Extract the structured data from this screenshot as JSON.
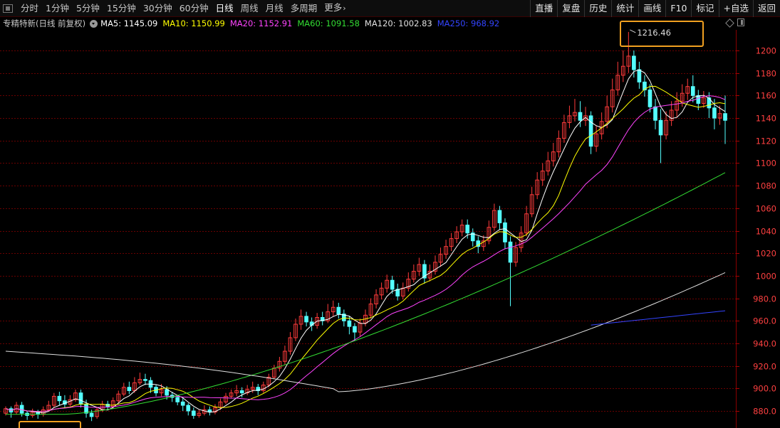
{
  "toolbar": {
    "periods": [
      {
        "label": "分时"
      },
      {
        "label": "1分钟"
      },
      {
        "label": "5分钟"
      },
      {
        "label": "15分钟"
      },
      {
        "label": "30分钟"
      },
      {
        "label": "60分钟"
      },
      {
        "label": "日线"
      },
      {
        "label": "周线"
      },
      {
        "label": "月线"
      },
      {
        "label": "多周期"
      },
      {
        "label": "更多"
      }
    ],
    "active_period": "日线",
    "tools": [
      {
        "label": "直播"
      },
      {
        "label": "复盘"
      },
      {
        "label": "历史"
      },
      {
        "label": "统计"
      },
      {
        "label": "画线"
      },
      {
        "label": "F10"
      },
      {
        "label": "标记"
      },
      {
        "label": "+自选"
      },
      {
        "label": "返回"
      }
    ]
  },
  "legend": {
    "title": "专精特新(日线 前复权)",
    "items": [
      {
        "label": "MA5:",
        "value": "1145.09",
        "color": "#ffffff"
      },
      {
        "label": "MA10:",
        "value": "1150.99",
        "color": "#ffff00"
      },
      {
        "label": "MA20:",
        "value": "1152.91",
        "color": "#ff44ff"
      },
      {
        "label": "MA60:",
        "value": "1091.58",
        "color": "#33dd33"
      },
      {
        "label": "MA120:",
        "value": "1002.83",
        "color": "#e0e0e0"
      },
      {
        "label": "MA250:",
        "value": "968.92",
        "color": "#3344ff"
      }
    ]
  },
  "chart_data": {
    "type": "candlestick",
    "ylim": [
      870,
      1217
    ],
    "y_ticks": [
      "880.0",
      "900.0",
      "920.0",
      "940.0",
      "960.0",
      "980.0",
      "1000",
      "1020",
      "1040",
      "1060",
      "1080",
      "1100",
      "1120",
      "1140",
      "1160",
      "1180",
      "1200"
    ],
    "grid": true,
    "colors": {
      "up": "#ff3b3b",
      "down": "#54ffff",
      "grid": "#6a0000"
    },
    "annotation": {
      "label": "1216.46",
      "value": 1216.46
    },
    "candles": [
      [
        878,
        882,
        876,
        884
      ],
      [
        882,
        879,
        874,
        884
      ],
      [
        879,
        885,
        877,
        888
      ],
      [
        885,
        878,
        875,
        888
      ],
      [
        878,
        876,
        872,
        880
      ],
      [
        876,
        879,
        874,
        882
      ],
      [
        879,
        877,
        873,
        881
      ],
      [
        877,
        881,
        875,
        884
      ],
      [
        881,
        885,
        880,
        889
      ],
      [
        885,
        893,
        883,
        896
      ],
      [
        893,
        889,
        885,
        897
      ],
      [
        889,
        886,
        883,
        894
      ],
      [
        886,
        890,
        884,
        894
      ],
      [
        890,
        896,
        888,
        899
      ],
      [
        896,
        886,
        883,
        899
      ],
      [
        886,
        878,
        874,
        890
      ],
      [
        878,
        875,
        871,
        881
      ],
      [
        875,
        881,
        873,
        883
      ],
      [
        881,
        886,
        879,
        889
      ],
      [
        886,
        884,
        881,
        889
      ],
      [
        884,
        889,
        882,
        892
      ],
      [
        889,
        895,
        887,
        898
      ],
      [
        895,
        901,
        893,
        905
      ],
      [
        901,
        898,
        895,
        906
      ],
      [
        898,
        905,
        896,
        910
      ],
      [
        905,
        908,
        903,
        914
      ],
      [
        908,
        907,
        903,
        913
      ],
      [
        907,
        901,
        896,
        910
      ],
      [
        901,
        896,
        893,
        903
      ],
      [
        896,
        899,
        893,
        904
      ],
      [
        899,
        894,
        890,
        902
      ],
      [
        894,
        892,
        888,
        897
      ],
      [
        892,
        888,
        885,
        894
      ],
      [
        888,
        885,
        880,
        892
      ],
      [
        885,
        880,
        876,
        887
      ],
      [
        880,
        876,
        873,
        883
      ],
      [
        876,
        878,
        874,
        881
      ],
      [
        878,
        881,
        876,
        885
      ],
      [
        881,
        879,
        876,
        884
      ],
      [
        879,
        883,
        877,
        886
      ],
      [
        883,
        888,
        881,
        891
      ],
      [
        888,
        893,
        886,
        896
      ],
      [
        893,
        896,
        891,
        899
      ],
      [
        896,
        898,
        893,
        903
      ],
      [
        898,
        896,
        892,
        901
      ],
      [
        896,
        899,
        894,
        903
      ],
      [
        899,
        901,
        896,
        906
      ],
      [
        901,
        898,
        894,
        904
      ],
      [
        898,
        903,
        896,
        906
      ],
      [
        903,
        910,
        901,
        913
      ],
      [
        910,
        918,
        908,
        921
      ],
      [
        918,
        924,
        915,
        928
      ],
      [
        924,
        933,
        921,
        938
      ],
      [
        933,
        945,
        930,
        950
      ],
      [
        945,
        957,
        942,
        962
      ],
      [
        957,
        964,
        952,
        970
      ],
      [
        964,
        959,
        955,
        968
      ],
      [
        959,
        956,
        951,
        963
      ],
      [
        956,
        963,
        953,
        967
      ],
      [
        963,
        960,
        956,
        968
      ],
      [
        960,
        968,
        958,
        975
      ],
      [
        968,
        972,
        964,
        978
      ],
      [
        972,
        966,
        962,
        976
      ],
      [
        966,
        960,
        955,
        970
      ],
      [
        960,
        955,
        948,
        964
      ],
      [
        955,
        950,
        942,
        958
      ],
      [
        950,
        958,
        946,
        962
      ],
      [
        958,
        965,
        955,
        970
      ],
      [
        965,
        975,
        962,
        980
      ],
      [
        975,
        983,
        971,
        988
      ],
      [
        983,
        989,
        979,
        994
      ],
      [
        989,
        996,
        985,
        1001
      ],
      [
        996,
        988,
        984,
        1000
      ],
      [
        988,
        982,
        978,
        993
      ],
      [
        982,
        989,
        979,
        994
      ],
      [
        989,
        997,
        986,
        1003
      ],
      [
        997,
        1004,
        994,
        1010
      ],
      [
        1004,
        1010,
        1000,
        1016
      ],
      [
        1010,
        998,
        993,
        1014
      ],
      [
        998,
        1004,
        995,
        1010
      ],
      [
        1004,
        1012,
        1001,
        1018
      ],
      [
        1012,
        1019,
        1008,
        1025
      ],
      [
        1019,
        1026,
        1015,
        1032
      ],
      [
        1026,
        1033,
        1022,
        1038
      ],
      [
        1033,
        1039,
        1029,
        1044
      ],
      [
        1039,
        1045,
        1035,
        1050
      ],
      [
        1045,
        1038,
        1033,
        1050
      ],
      [
        1038,
        1031,
        1026,
        1042
      ],
      [
        1031,
        1026,
        1020,
        1035
      ],
      [
        1026,
        1031,
        1022,
        1036
      ],
      [
        1031,
        1043,
        1028,
        1049
      ],
      [
        1043,
        1058,
        1040,
        1064
      ],
      [
        1058,
        1047,
        1041,
        1062
      ],
      [
        1047,
        1030,
        1024,
        1051
      ],
      [
        1030,
        1012,
        973,
        1035
      ],
      [
        1012,
        1025,
        1008,
        1030
      ],
      [
        1025,
        1038,
        1021,
        1044
      ],
      [
        1038,
        1055,
        1035,
        1062
      ],
      [
        1055,
        1072,
        1052,
        1079
      ],
      [
        1072,
        1085,
        1068,
        1092
      ],
      [
        1085,
        1093,
        1080,
        1100
      ],
      [
        1093,
        1102,
        1089,
        1110
      ],
      [
        1102,
        1110,
        1097,
        1118
      ],
      [
        1110,
        1122,
        1105,
        1129
      ],
      [
        1122,
        1136,
        1118,
        1143
      ],
      [
        1136,
        1142,
        1131,
        1151
      ],
      [
        1142,
        1145,
        1137,
        1157
      ],
      [
        1145,
        1138,
        1132,
        1155
      ],
      [
        1138,
        1142,
        1133,
        1150
      ],
      [
        1142,
        1115,
        1108,
        1146
      ],
      [
        1115,
        1126,
        1110,
        1133
      ],
      [
        1126,
        1137,
        1121,
        1145
      ],
      [
        1137,
        1150,
        1131,
        1160
      ],
      [
        1150,
        1165,
        1145,
        1175
      ],
      [
        1165,
        1178,
        1160,
        1190
      ],
      [
        1178,
        1186,
        1172,
        1200
      ],
      [
        1186,
        1195,
        1180,
        1216.46
      ],
      [
        1195,
        1183,
        1176,
        1200
      ],
      [
        1183,
        1172,
        1166,
        1190
      ],
      [
        1172,
        1165,
        1159,
        1178
      ],
      [
        1165,
        1150,
        1145,
        1170
      ],
      [
        1150,
        1138,
        1130,
        1157
      ],
      [
        1138,
        1125,
        1100,
        1148
      ],
      [
        1125,
        1138,
        1121,
        1146
      ],
      [
        1138,
        1147,
        1133,
        1155
      ],
      [
        1147,
        1155,
        1141,
        1163
      ],
      [
        1155,
        1162,
        1150,
        1170
      ],
      [
        1162,
        1168,
        1156,
        1175
      ],
      [
        1168,
        1160,
        1154,
        1178
      ],
      [
        1160,
        1153,
        1147,
        1165
      ],
      [
        1153,
        1158,
        1149,
        1164
      ],
      [
        1158,
        1149,
        1140,
        1163
      ],
      [
        1149,
        1140,
        1130,
        1157
      ],
      [
        1140,
        1144,
        1134,
        1151
      ],
      [
        1144,
        1138,
        1117,
        1160
      ]
    ],
    "ma60_end": 1091.58,
    "ma120_end": 1002.83,
    "ma250_end": 968.92
  }
}
